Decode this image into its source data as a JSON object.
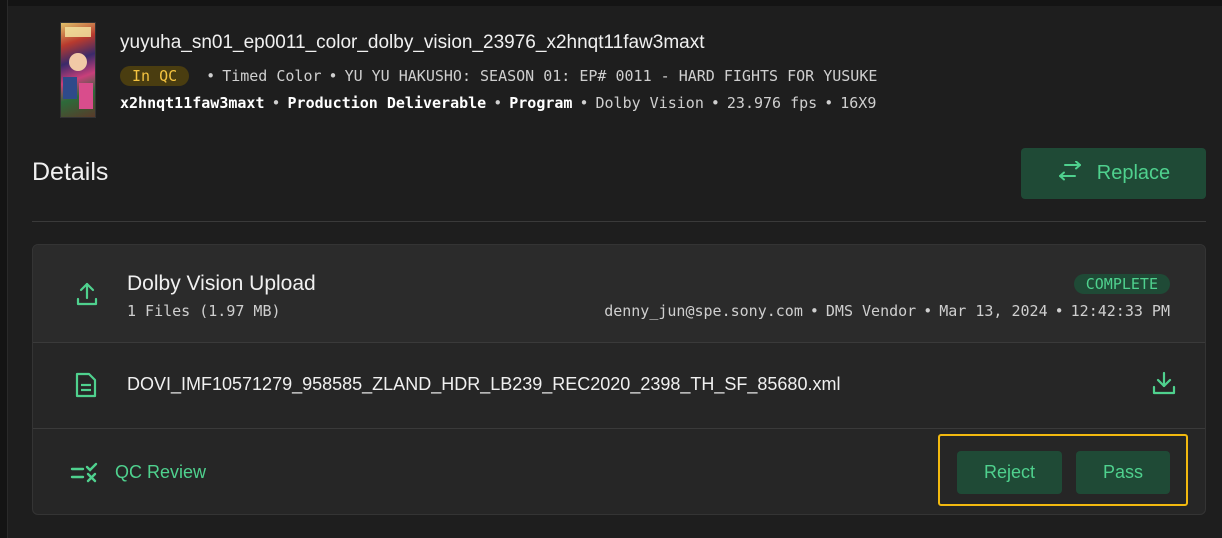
{
  "asset": {
    "title": "yuyuha_sn01_ep0011_color_dolby_vision_23976_x2hnqt11faw3maxt",
    "status": "In QC",
    "type": "Timed Color",
    "series_episode": "YU YU HAKUSHO: SEASON 01: EP# 0011 - HARD FIGHTS FOR YUSUKE",
    "id": "x2hnqt11faw3maxt",
    "deliverable": "Production Deliverable",
    "program": "Program",
    "format": "Dolby Vision",
    "frame_rate": "23.976 fps",
    "aspect": "16X9"
  },
  "details": {
    "title": "Details",
    "replace_label": "Replace"
  },
  "upload": {
    "title": "Dolby Vision Upload",
    "files": "1 Files (1.97 MB)",
    "status": "COMPLETE",
    "user": "denny_jun@spe.sony.com",
    "role": "DMS Vendor",
    "date": "Mar 13, 2024",
    "time": "12:42:33 PM"
  },
  "file": {
    "name": "DOVI_IMF10571279_958585_ZLAND_HDR_LB239_REC2020_2398_TH_SF_85680.xml"
  },
  "qc": {
    "label": "QC Review",
    "reject_label": "Reject",
    "pass_label": "Pass"
  },
  "colors": {
    "accent": "#4fd18e",
    "accent_bg": "#1f4a36",
    "status_yellow": "#f4c340",
    "highlight": "#f2b90f"
  }
}
